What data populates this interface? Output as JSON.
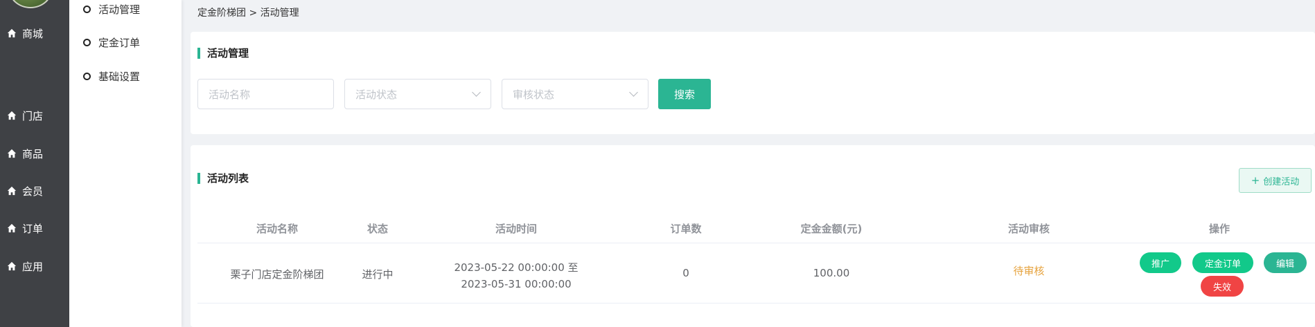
{
  "nav": {
    "items": [
      {
        "label": "商城",
        "icon": "home-icon"
      },
      {
        "label": "门店",
        "icon": "home-icon"
      },
      {
        "label": "商品",
        "icon": "home-icon"
      },
      {
        "label": "会员",
        "icon": "home-icon"
      },
      {
        "label": "订单",
        "icon": "home-icon"
      },
      {
        "label": "应用",
        "icon": "home-icon"
      }
    ]
  },
  "submenu": {
    "items": [
      {
        "label": "活动管理"
      },
      {
        "label": "定金订单"
      },
      {
        "label": "基础设置"
      }
    ]
  },
  "breadcrumb": "定金阶梯团 > 活动管理",
  "search_card": {
    "title": "活动管理",
    "name_placeholder": "活动名称",
    "status_placeholder": "活动状态",
    "audit_placeholder": "审核状态",
    "search_label": "搜索"
  },
  "list_card": {
    "title": "活动列表",
    "create_label": "创建活动",
    "columns": [
      "活动名称",
      "状态",
      "活动时间",
      "订单数",
      "定金金额(元)",
      "活动审核",
      "操作"
    ],
    "rows": [
      {
        "name": "栗子门店定金阶梯团",
        "status": "进行中",
        "time_start": "2023-05-22 00:00:00 至",
        "time_end": "2023-05-31 00:00:00",
        "orders": "0",
        "deposit": "100.00",
        "audit": "待审核",
        "actions": {
          "promote": "推广",
          "deposit_orders": "定金订单",
          "edit": "编辑",
          "invalidate": "失效"
        }
      }
    ]
  },
  "colors": {
    "accent": "#2bb593",
    "audit_pending": "#e6a23c",
    "btn_green": "#12c98a",
    "btn_red": "#f04444",
    "nav_bg": "#3f4145"
  }
}
